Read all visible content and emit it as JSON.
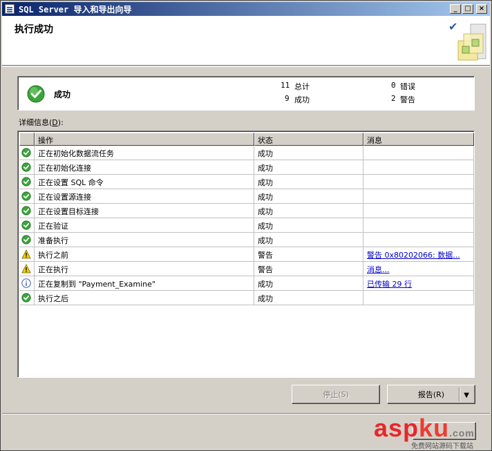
{
  "window": {
    "title": "SQL Server 导入和导出向导",
    "controls": [
      "minimize",
      "maximize",
      "close"
    ]
  },
  "header": {
    "title": "执行成功"
  },
  "summary": {
    "status": "成功",
    "total_count": "11",
    "total_label": "总计",
    "success_count": "9",
    "success_label": "成功",
    "error_count": "0",
    "error_label": "错误",
    "warning_count": "2",
    "warning_label": "警告"
  },
  "details": {
    "label_prefix": "详细信息(",
    "label_hotkey": "D",
    "label_suffix": "):",
    "columns": [
      "操作",
      "状态",
      "消息"
    ],
    "rows": [
      {
        "icon": "success-icon",
        "action": "正在初始化数据流任务",
        "status": "成功",
        "message": ""
      },
      {
        "icon": "success-icon",
        "action": "正在初始化连接",
        "status": "成功",
        "message": ""
      },
      {
        "icon": "success-icon",
        "action": "正在设置 SQL 命令",
        "status": "成功",
        "message": ""
      },
      {
        "icon": "success-icon",
        "action": "正在设置源连接",
        "status": "成功",
        "message": ""
      },
      {
        "icon": "success-icon",
        "action": "正在设置目标连接",
        "status": "成功",
        "message": ""
      },
      {
        "icon": "success-icon",
        "action": "正在验证",
        "status": "成功",
        "message": ""
      },
      {
        "icon": "success-icon",
        "action": "准备执行",
        "status": "成功",
        "message": ""
      },
      {
        "icon": "warning-icon",
        "action": "执行之前",
        "status": "警告",
        "message": "警告 0x80202066: 数据..."
      },
      {
        "icon": "warning-icon",
        "action": "正在执行",
        "status": "警告",
        "message": "消息..."
      },
      {
        "icon": "info-icon",
        "action": "正在复制到 \"Payment_Examine\"",
        "status": "成功",
        "message": "已传输 29 行"
      },
      {
        "icon": "success-icon",
        "action": "执行之后",
        "status": "成功",
        "message": ""
      }
    ]
  },
  "buttons": {
    "stop": "停止(S)",
    "report": "报告(R)"
  },
  "watermark": {
    "brand_asp": "asp",
    "brand_ku": "ku",
    "brand_cn": ".com",
    "tagline": "免费网站源码下载站"
  },
  "colors": {
    "titlebar_start": "#0a246a",
    "titlebar_end": "#a6caf0",
    "success_green": "#3aa63a",
    "warning_yellow": "#f5d000",
    "link_blue": "#0000cc"
  }
}
